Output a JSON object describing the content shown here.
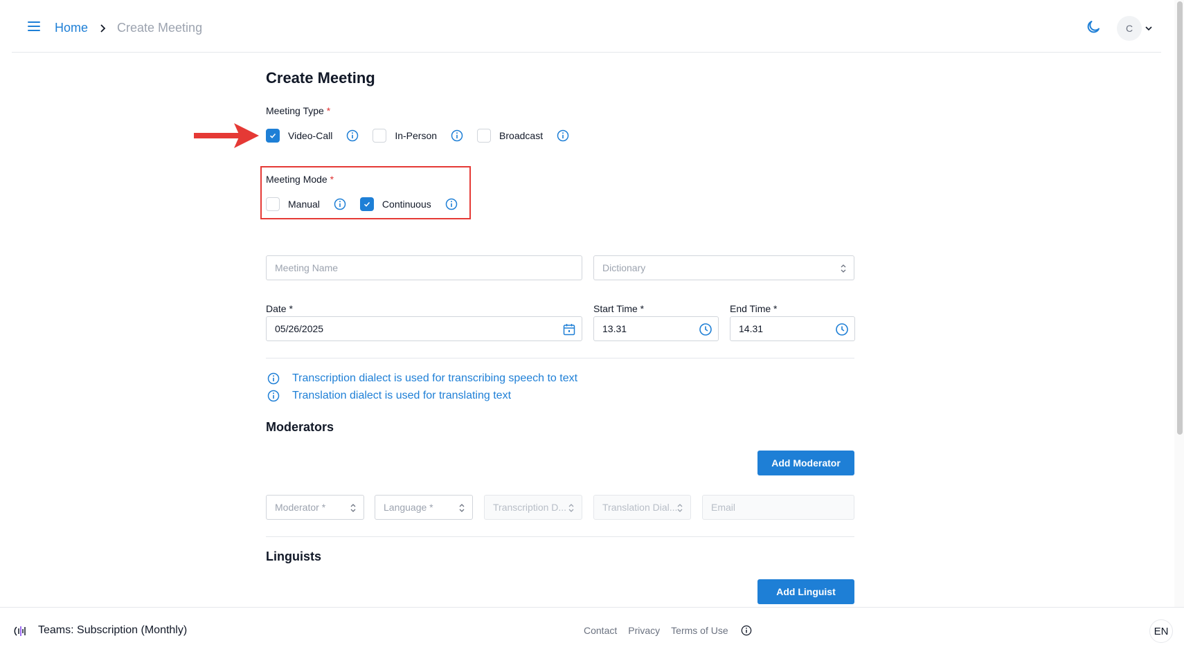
{
  "header": {
    "breadcrumb_home": "Home",
    "breadcrumb_current": "Create Meeting",
    "avatar_initial": "C"
  },
  "page": {
    "title": "Create Meeting"
  },
  "meeting_type": {
    "label": "Meeting Type",
    "required_mark": "*",
    "options": [
      {
        "label": "Video-Call",
        "checked": true
      },
      {
        "label": "In-Person",
        "checked": false
      },
      {
        "label": "Broadcast",
        "checked": false
      }
    ]
  },
  "meeting_mode": {
    "label": "Meeting Mode",
    "required_mark": "*",
    "options": [
      {
        "label": "Manual",
        "checked": false
      },
      {
        "label": "Continuous",
        "checked": true
      }
    ]
  },
  "fields": {
    "meeting_name_placeholder": "Meeting Name",
    "dictionary_placeholder": "Dictionary",
    "date_label": "Date *",
    "date_value": "05/26/2025",
    "start_time_label": "Start Time *",
    "start_time_value": "13.31",
    "end_time_label": "End Time *",
    "end_time_value": "14.31"
  },
  "info_notes": [
    "Transcription dialect is used for transcribing speech to text",
    "Translation dialect is used for translating text"
  ],
  "moderators": {
    "title": "Moderators",
    "add_button": "Add Moderator",
    "row": {
      "moderator_placeholder": "Moderator *",
      "language_placeholder": "Language *",
      "transcription_placeholder": "Transcription D...",
      "translation_placeholder": "Translation Dial...",
      "email_placeholder": "Email"
    }
  },
  "linguists": {
    "title": "Linguists",
    "add_button": "Add Linguist"
  },
  "footer": {
    "plan": "Teams: Subscription (Monthly)",
    "links": [
      "Contact",
      "Privacy",
      "Terms of Use"
    ],
    "language": "EN"
  },
  "colors": {
    "accent": "#1e7fd6",
    "highlight": "#e53935"
  },
  "icons": [
    "menu-icon",
    "chevron-right-icon",
    "moon-icon",
    "chevron-down-icon",
    "check-icon",
    "info-icon",
    "calendar-icon",
    "clock-icon",
    "sort-arrows-icon",
    "logo-icon",
    "arrow-annotation"
  ]
}
